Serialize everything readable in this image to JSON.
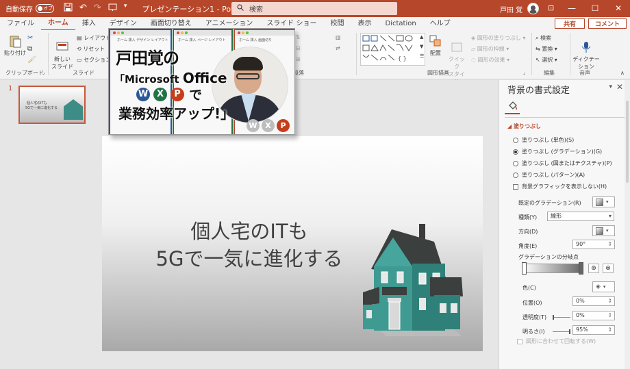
{
  "titlebar": {
    "autosave_label": "自動保存",
    "autosave_state": "オフ",
    "doc_title": "プレゼンテーション1 - PowerPoint",
    "search_placeholder": "検索",
    "user_name": "戸田 覚",
    "win_min": "—",
    "win_max": "☐",
    "win_close": "✕"
  },
  "tabs": [
    {
      "label": "ファイル"
    },
    {
      "label": "ホーム",
      "active": true
    },
    {
      "label": "挿入"
    },
    {
      "label": "デザイン"
    },
    {
      "label": "画面切り替え"
    },
    {
      "label": "アニメーション"
    },
    {
      "label": "スライド ショー"
    },
    {
      "label": "校閲"
    },
    {
      "label": "表示"
    },
    {
      "label": "Dictation"
    },
    {
      "label": "ヘルプ"
    }
  ],
  "share": {
    "share_label": "共有",
    "comment_label": "コメント"
  },
  "ribbon": {
    "paste": "貼り付け",
    "new_slide": "新しい\nスライド",
    "layout": "レイアウト",
    "reset": "リセット",
    "section": "セクション",
    "clipboard_group": "クリップボード",
    "slides_group": "スライド",
    "paragraph_group": "段落",
    "arrange": "配置",
    "quick_style": "クイック\nスタイル",
    "shape_fill": "図形の塗りつぶし",
    "shape_outline": "図形の枠線",
    "shape_effect": "図形の効果",
    "drawing_group": "図形描画",
    "find": "検索",
    "replace": "置換",
    "select": "選択",
    "editing_group": "編集",
    "dictation": "ディクテー\nション",
    "voice_group": "音声"
  },
  "thumbnails": {
    "slide_number": "1",
    "line1": "個人宅のITも",
    "line2": "5Gで一気に進化する"
  },
  "slide": {
    "title_line1": "個人宅のITも",
    "title_line2": "5Gで一気に進化する"
  },
  "banner": {
    "name": "戸田覚の",
    "line2_prefix": "「Microsoft ",
    "line2_bold": "Office",
    "letters": [
      "W",
      "X",
      "P"
    ],
    "line3_suffix": "で",
    "line4": "業務効率アップ!」",
    "colors": {
      "word": "#2b579a",
      "excel": "#217346",
      "powerpoint": "#c43e1c"
    },
    "mini_tabs": [
      "ホーム",
      "挿入",
      "デザイン",
      "レイアウト",
      "ページ レイアウト",
      "画面切り"
    ]
  },
  "pane": {
    "title": "背景の書式設定",
    "fill_header": "塗りつぶし",
    "options": [
      {
        "label": "塗りつぶし (単色)(S)",
        "checked": false
      },
      {
        "label": "塗りつぶし (グラデーション)(G)",
        "checked": true
      },
      {
        "label": "塗りつぶし (図またはテクスチャ)(P)",
        "checked": false
      },
      {
        "label": "塗りつぶし (パターン)(A)",
        "checked": false
      }
    ],
    "hide_graphics": "背景グラフィックを表示しない(H)",
    "preset_label": "既定のグラデーション(R)",
    "type_label": "種類(Y)",
    "type_value": "線形",
    "direction_label": "方向(D)",
    "angle_label": "角度(E)",
    "angle_value": "90°",
    "stops_label": "グラデーションの分岐点",
    "color_label": "色(C)",
    "position_label": "位置(O)",
    "position_value": "0%",
    "transparency_label": "透明度(T)",
    "transparency_value": "0%",
    "brightness_label": "明るさ(I)",
    "brightness_value": "95%",
    "rotate_label": "図形に合わせて回転する(W)"
  }
}
